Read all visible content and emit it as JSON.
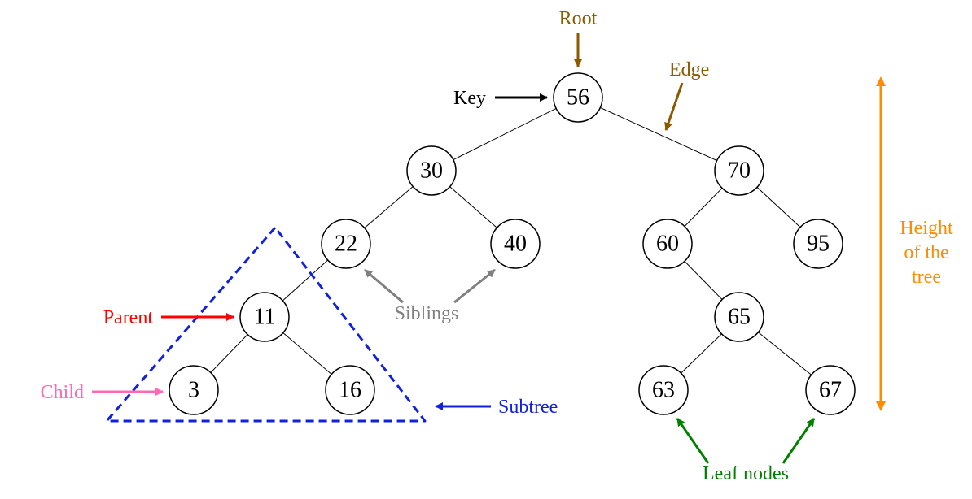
{
  "labels": {
    "root": "Root",
    "key": "Key",
    "edge": "Edge",
    "parent": "Parent",
    "child": "Child",
    "siblings": "Siblings",
    "subtree": "Subtree",
    "leaf": "Leaf nodes",
    "height_line1": "Height",
    "height_line2": "of the",
    "height_line3": "tree"
  },
  "colors": {
    "root": "#8b5a00",
    "key": "#000000",
    "edge": "#8b5a00",
    "parent": "#ff0000",
    "child": "#ff69b4",
    "siblings": "#808080",
    "subtree": "#1020dd",
    "leaf": "#008000",
    "height": "#ff8c00"
  },
  "nodes": {
    "n56": "56",
    "n30": "30",
    "n70": "70",
    "n22": "22",
    "n40": "40",
    "n60": "60",
    "n95": "95",
    "n11": "11",
    "n65": "65",
    "n3": "3",
    "n16": "16",
    "n63": "63",
    "n67": "67"
  },
  "chart_data": {
    "type": "tree",
    "title": "Binary Search Tree Terminology",
    "root": 56,
    "edges": [
      [
        56,
        30
      ],
      [
        56,
        70
      ],
      [
        30,
        22
      ],
      [
        30,
        40
      ],
      [
        70,
        60
      ],
      [
        70,
        95
      ],
      [
        22,
        11
      ],
      [
        60,
        65
      ],
      [
        11,
        3
      ],
      [
        11,
        16
      ],
      [
        65,
        63
      ],
      [
        65,
        67
      ]
    ],
    "annotations": {
      "root_node": 56,
      "key_example": 56,
      "edge_example": [
        56,
        70
      ],
      "parent_example": 11,
      "child_example": 3,
      "siblings_example": [
        22,
        40
      ],
      "subtree_root": 11,
      "subtree_members": [
        11,
        3,
        16
      ],
      "leaf_nodes": [
        63,
        67
      ],
      "height_levels": 5
    }
  }
}
